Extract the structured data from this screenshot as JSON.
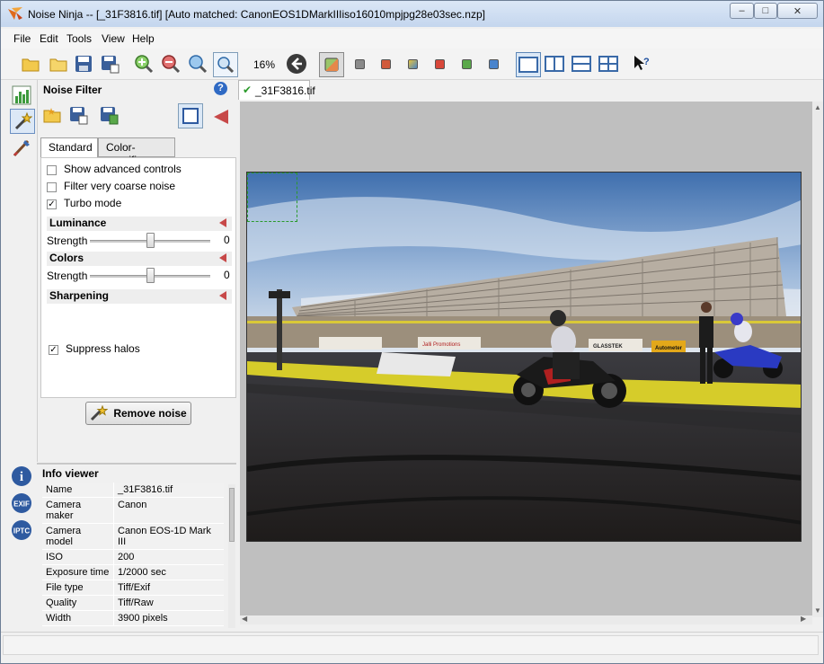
{
  "window": {
    "title": "Noise Ninja -- [_31F3816.tif] [Auto matched: CanonEOS1DMarkIIIiso16010mpjpg28e03sec.nzp]",
    "min_label": "–",
    "max_label": "□",
    "close_label": "✕"
  },
  "menubar": {
    "items": [
      {
        "label": "File"
      },
      {
        "label": "Edit"
      },
      {
        "label": "Tools"
      },
      {
        "label": "View"
      },
      {
        "label": "Help"
      }
    ]
  },
  "toolbar": {
    "zoom_level": "16%",
    "colors": {
      "swatch_gray": "#8a8a8a",
      "swatch_red1": "#d05a3c",
      "swatch_multi": "#4a86c6",
      "swatch_red2": "#d8473a",
      "swatch_green": "#5aa84a",
      "swatch_blue": "#4a84cc"
    }
  },
  "noise_filter": {
    "title": "Noise Filter",
    "help_label": "?",
    "tabs": [
      {
        "label": "Standard"
      },
      {
        "label": "Color-specific"
      }
    ],
    "checkboxes": {
      "advanced": {
        "label": "Show advanced controls",
        "checked": false
      },
      "coarse": {
        "label": "Filter very coarse noise",
        "checked": false
      },
      "turbo": {
        "label": "Turbo mode",
        "checked": true,
        "mark": "✓"
      },
      "halos": {
        "label": "Suppress halos",
        "checked": true,
        "mark": "✓"
      }
    },
    "luminance": {
      "title": "Luminance",
      "strength_label": "Strength",
      "value": "0",
      "position": 0.5
    },
    "colors": {
      "title": "Colors",
      "strength_label": "Strength",
      "value": "0",
      "position": 0.5
    },
    "sharpening": {
      "title": "Sharpening"
    },
    "remove_button": "Remove noise"
  },
  "info_viewer": {
    "title": "Info viewer",
    "rows": [
      {
        "key": "Name",
        "value": "_31F3816.tif"
      },
      {
        "key": "Camera maker",
        "value": "Canon"
      },
      {
        "key": "Camera model",
        "value": "Canon EOS-1D Mark III"
      },
      {
        "key": "ISO",
        "value": "200"
      },
      {
        "key": "Exposure time",
        "value": "1/2000 sec"
      },
      {
        "key": "File type",
        "value": "Tiff/Exif"
      },
      {
        "key": "Quality",
        "value": "Tiff/Raw"
      },
      {
        "key": "Width",
        "value": "3900 pixels"
      }
    ],
    "side_icons": {
      "info": "i",
      "exif": "EXIF",
      "iptc": "IPTC"
    }
  },
  "document": {
    "tab_label": "_31F3816.tif",
    "tab_check": "✔",
    "photo": {
      "sign_1": "Jalli Promotions",
      "sign_2": "Autometer",
      "sign_3": "GLASSTEK"
    }
  }
}
